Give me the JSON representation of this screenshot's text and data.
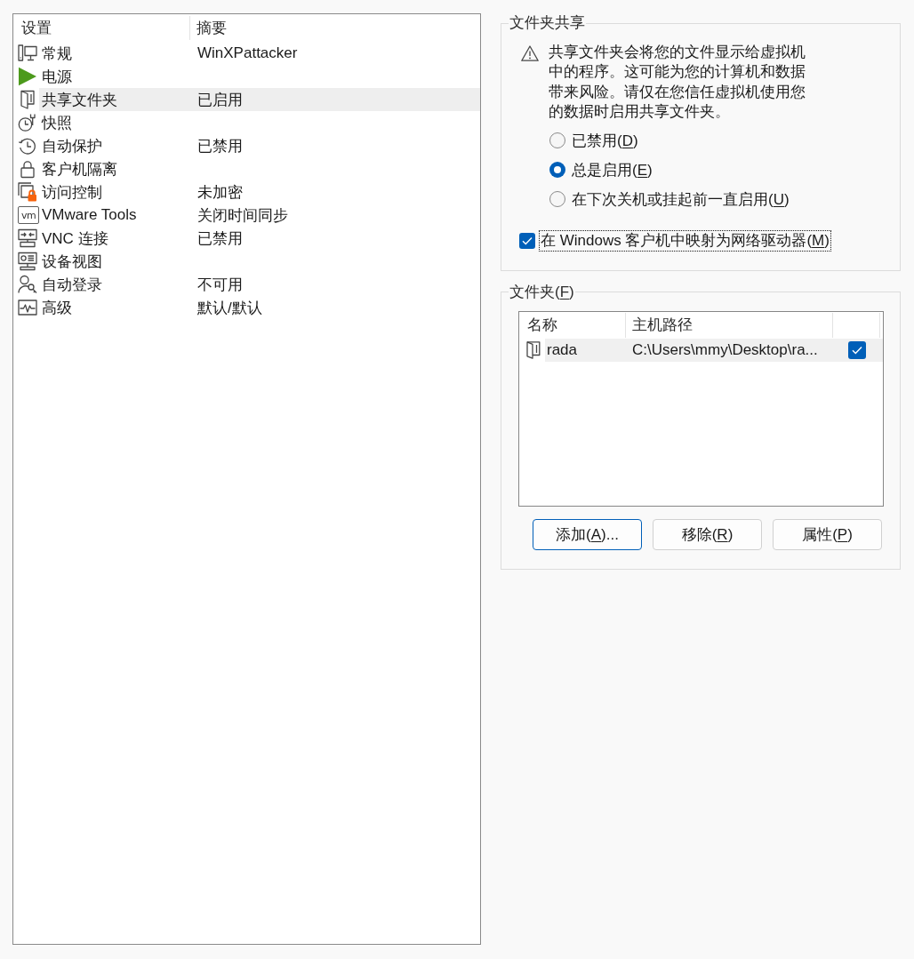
{
  "settings": {
    "columns": [
      "设置",
      "摘要"
    ],
    "items": [
      {
        "kind": "general",
        "name": "常规",
        "summary": "WinXPattacker",
        "selected": false
      },
      {
        "kind": "power",
        "name": "电源",
        "selected": false
      },
      {
        "kind": "sharing",
        "name": "共享文件夹",
        "summary": "已启用",
        "selected": true
      },
      {
        "kind": "snapshots",
        "name": "快照",
        "selected": false
      },
      {
        "kind": "autoprotect",
        "name": "自动保护",
        "summary": "已禁用",
        "selected": false
      },
      {
        "kind": "isolation",
        "name": "客户机隔离",
        "selected": false
      },
      {
        "kind": "access",
        "name": "访问控制",
        "summary": "未加密",
        "selected": false
      },
      {
        "kind": "tools",
        "icon_label": "vm",
        "name": "VMware Tools",
        "summary": "关闭时间同步",
        "selected": false
      },
      {
        "kind": "vnc",
        "name": "VNC 连接",
        "summary": "已禁用",
        "selected": false
      },
      {
        "kind": "devices",
        "name": "设备视图",
        "selected": false
      },
      {
        "kind": "autologin",
        "name": "自动登录",
        "summary": "不可用",
        "selected": false
      },
      {
        "kind": "advanced",
        "name": "高级",
        "summary": "默认/默认",
        "selected": false
      }
    ]
  },
  "folder_sharing": {
    "title": "文件夹共享",
    "warning": "共享文件夹会将您的文件显示给虚拟机中的程序。这可能为您的计算机和数据带来风险。请仅在您信任虚拟机使用您的数据时启用共享文件夹。",
    "options": [
      {
        "label": [
          "已禁用(",
          "D",
          ")"
        ],
        "selected": false
      },
      {
        "label": [
          "总是启用(",
          "E",
          ")"
        ],
        "selected": true
      },
      {
        "label": [
          "在下次关机或挂起前一直启用(",
          "U",
          ")"
        ],
        "selected": false
      }
    ],
    "map_drive": {
      "label": [
        "在 Windows 客户机中映射为网络驱动器(",
        "M",
        ")"
      ],
      "checked": true,
      "focused": true
    }
  },
  "folders": {
    "title": [
      "文件夹(",
      "F",
      ")"
    ],
    "columns": [
      "名称",
      "主机路径"
    ],
    "rows": [
      {
        "name": "rada",
        "path": "C:\\Users\\mmy\\Desktop\\ra...",
        "enabled": true,
        "selected": true
      }
    ],
    "buttons": [
      {
        "label": [
          "添加(",
          "A",
          ")..."
        ],
        "default": true
      },
      {
        "label": [
          "移除(",
          "R",
          ")"
        ],
        "default": false
      },
      {
        "label": [
          "属性(",
          "P",
          ")"
        ],
        "default": false
      }
    ]
  }
}
